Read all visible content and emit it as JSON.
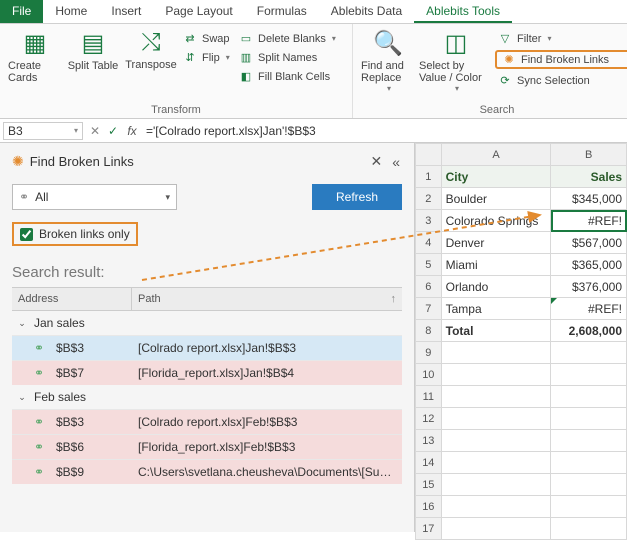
{
  "tabs": {
    "file": "File",
    "home": "Home",
    "insert": "Insert",
    "pagelayout": "Page Layout",
    "formulas": "Formulas",
    "abdata": "Ablebits Data",
    "abtools": "Ablebits Tools"
  },
  "ribbon": {
    "transform_label": "Transform",
    "search_label": "Search",
    "create_cards": "Create Cards",
    "split_table": "Split Table",
    "transpose": "Transpose",
    "swap": "Swap",
    "flip": "Flip",
    "delete_blanks": "Delete Blanks",
    "split_names": "Split Names",
    "fill_blank": "Fill Blank Cells",
    "find_replace": "Find and Replace",
    "select_by": "Select by Value / Color",
    "filter": "Filter",
    "find_broken": "Find Broken Links",
    "sync_sel": "Sync Selection"
  },
  "formula_bar": {
    "cell": "B3",
    "formula": "='[Colrado report.xlsx]Jan'!$B$3"
  },
  "pane": {
    "title": "Find Broken Links",
    "filter_value": "All",
    "refresh": "Refresh",
    "only_broken": "Broken links only",
    "search_result": "Search result:",
    "col_addr": "Address",
    "col_path": "Path",
    "groups": [
      {
        "name": "Jan sales",
        "items": [
          {
            "addr": "$B$3",
            "path": "[Colrado report.xlsx]Jan!$B$3",
            "state": "sel"
          },
          {
            "addr": "$B$7",
            "path": "[Florida_report.xlsx]Jan!$B$4",
            "state": "err"
          }
        ]
      },
      {
        "name": "Feb sales",
        "items": [
          {
            "addr": "$B$3",
            "path": "[Colrado report.xlsx]Feb!$B$3",
            "state": "err"
          },
          {
            "addr": "$B$6",
            "path": "[Florida_report.xlsx]Feb!$B$3",
            "state": "err"
          },
          {
            "addr": "$B$9",
            "path": "C:\\Users\\svetlana.cheusheva\\Documents\\[Sum…",
            "state": "err"
          }
        ]
      }
    ]
  },
  "sheet": {
    "colA": "A",
    "colB": "B",
    "header_city": "City",
    "header_sales": "Sales",
    "rows": [
      {
        "a": "Boulder",
        "b": "$345,000"
      },
      {
        "a": "Colorado Springs",
        "b": "#REF!",
        "sel": true
      },
      {
        "a": "Denver",
        "b": "$567,000"
      },
      {
        "a": "Miami",
        "b": "$365,000"
      },
      {
        "a": "Orlando",
        "b": "$376,000"
      },
      {
        "a": "Tampa",
        "b": "#REF!",
        "tri": true
      },
      {
        "a": "Total",
        "b": "2,608,000",
        "bold": true
      }
    ]
  }
}
